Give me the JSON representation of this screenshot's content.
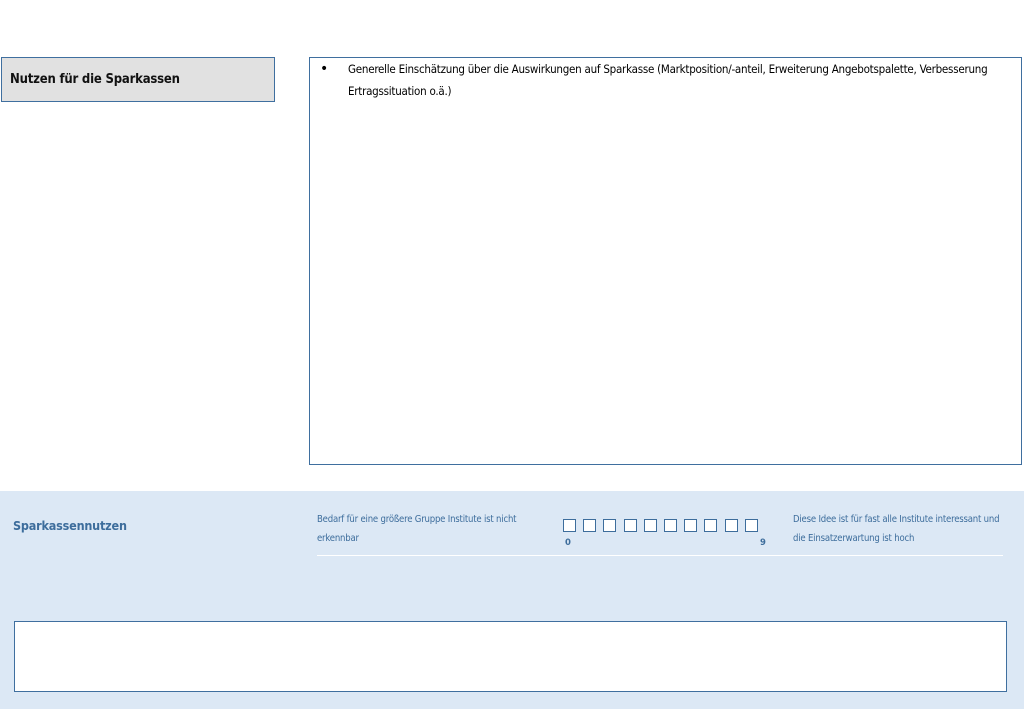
{
  "section": {
    "label": "Nutzen für die Sparkassen"
  },
  "content": {
    "bullets": [
      {
        "marker": "•",
        "text": "Generelle Einschätzung über die Auswirkungen auf Sparkasse (Marktposition/-anteil, Erweiterung Angebotspalette, Verbesserung Ertragssituation o.ä.)"
      }
    ]
  },
  "rating": {
    "title": "Sparkassennutzen",
    "low_description": "Bedarf für eine größere Gruppe Institute ist nicht erkennbar",
    "high_description": "Diese Idee ist für fast alle Institute interessant und die Einsatzerwartung ist hoch",
    "scale_min_label": "0",
    "scale_max_label": "9",
    "box_count": 10,
    "accent_color": "#3d6d9c",
    "panel_color": "#dce8f5"
  },
  "comment": {
    "value": ""
  }
}
